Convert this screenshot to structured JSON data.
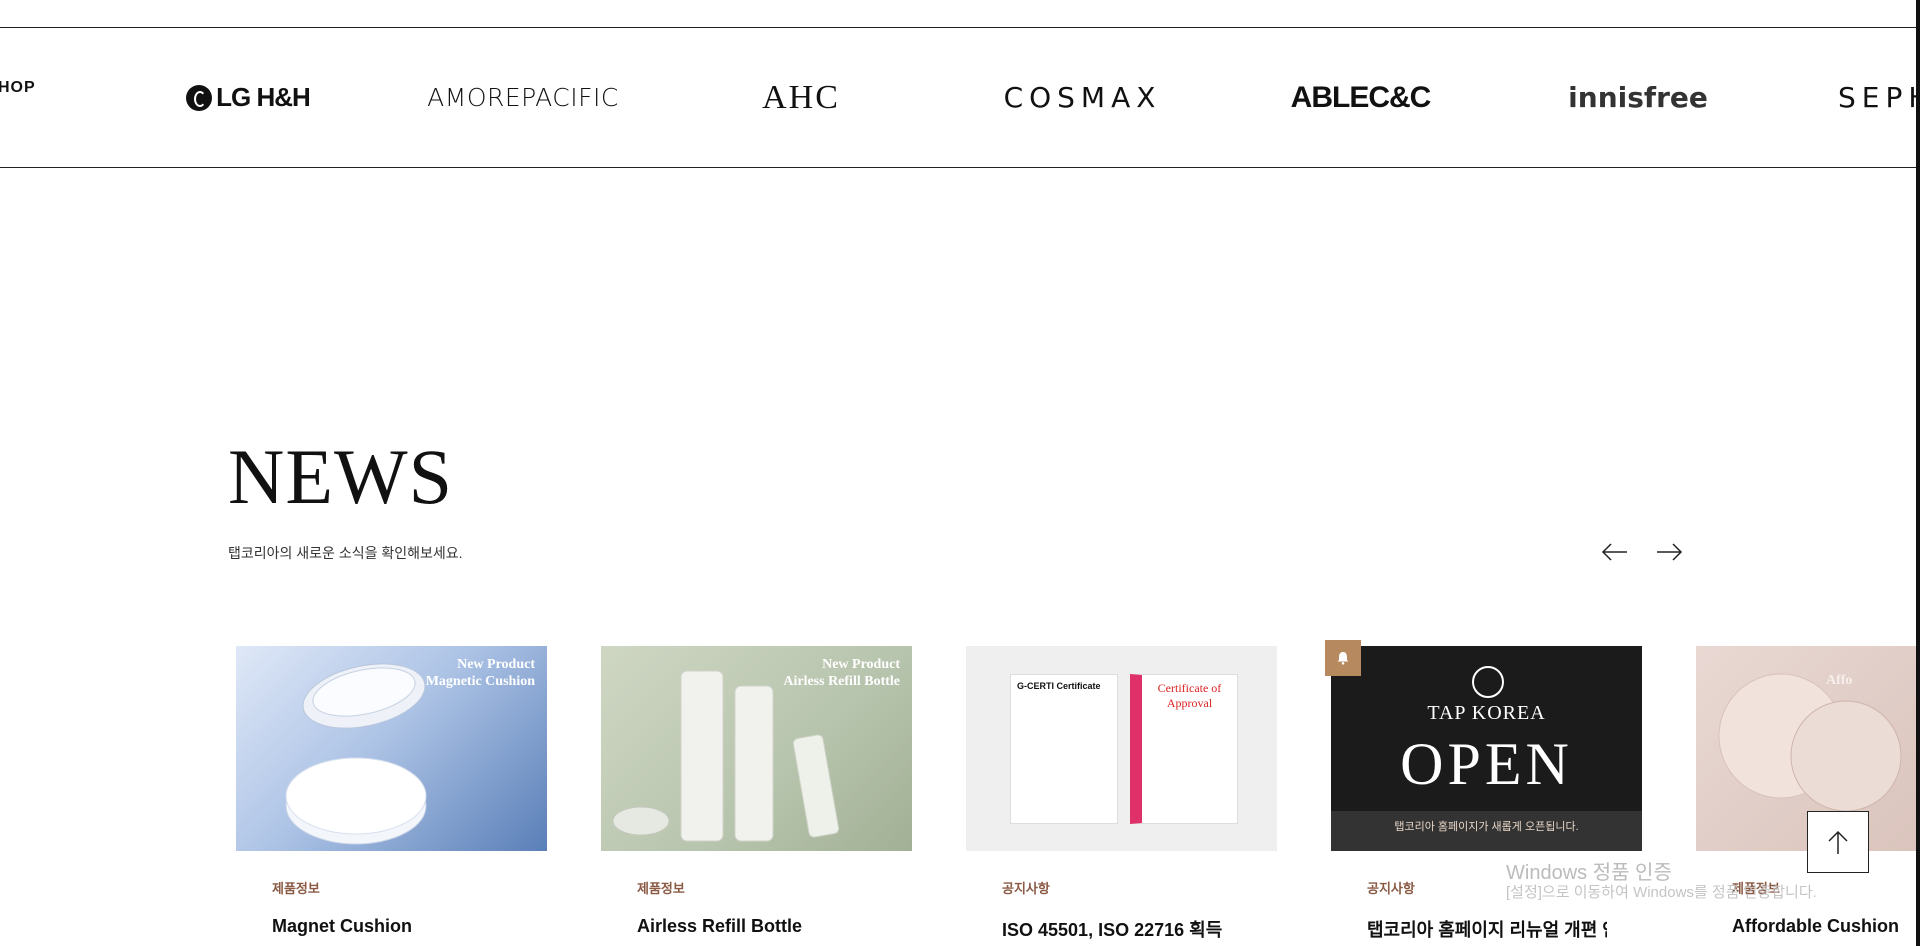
{
  "brands": {
    "shop": "HOP",
    "lg": "LG H&H",
    "amore": "AMOREPACIFIC",
    "ahc": "AHC",
    "cosmax": "COSMAX",
    "able": "ABLEC&C",
    "innisfree": "innisfree",
    "sephora": "SEPHORA"
  },
  "news": {
    "title": "NEWS",
    "subtitle": "탭코리아의 새로운 소식을 확인해보세요."
  },
  "cards": [
    {
      "category": "제품정보",
      "title": "Magnet Cushion",
      "overlay_line1": "New Product",
      "overlay_line2": "Magnetic Cushion"
    },
    {
      "category": "제품정보",
      "title": "Airless Refill Bottle",
      "overlay_line1": "New Product",
      "overlay_line2": "Airless Refill Bottle"
    },
    {
      "category": "공지사항",
      "title": "ISO 45501, ISO 22716 획득",
      "cert1_title": "G-CERTI Certificate",
      "cert2_title": "Certificate of Approval"
    },
    {
      "category": "공지사항",
      "title": "탭코리아 홈페이지 리뉴얼 개편 안내",
      "brand": "TAP KOREA",
      "big": "OPEN",
      "notice": "탭코리아 홈페이지가 새롭게 오픈됩니다."
    },
    {
      "category": "제품정보",
      "title": "Affordable Cushion",
      "overlay_line1": "Affo"
    }
  ],
  "watermark": {
    "line1": "Windows 정품 인증",
    "line2": "[설정]으로 이동하여 Windows를 정품 인증합니다."
  },
  "colors": {
    "accent": "#8a5a44",
    "bell": "#b68a5e"
  },
  "icons": {
    "prev": "arrow-left-icon",
    "next": "arrow-right-icon",
    "top": "arrow-up-icon",
    "notice": "bell-icon"
  }
}
